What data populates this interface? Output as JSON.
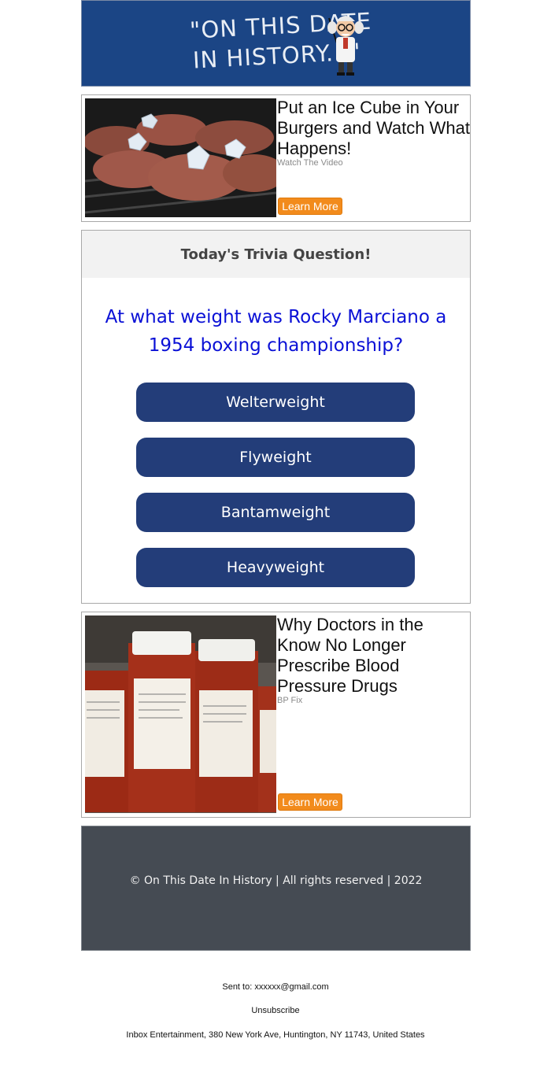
{
  "header": {
    "logo_line1": "\"ON THIS DATE",
    "logo_line2": "IN HISTORY...\""
  },
  "ads": [
    {
      "title": "Put an Ice Cube in Your Burgers and Watch What Happens!",
      "source": "Watch The Video",
      "button_label": "Learn More"
    },
    {
      "title": "Why Doctors in the Know No Longer Prescribe Blood Pressure Drugs",
      "source": "BP Fix",
      "button_label": "Learn More"
    }
  ],
  "trivia": {
    "heading": "Today's Trivia Question!",
    "question": "At what weight was Rocky Marciano a 1954 boxing championship?",
    "answers": [
      "Welterweight",
      "Flyweight",
      "Bantamweight",
      "Heavyweight"
    ]
  },
  "footer": {
    "copyright": "© On This Date In History | All rights reserved | 2022"
  },
  "meta": {
    "sent_to": "Sent to: xxxxxx@gmail.com",
    "unsubscribe": "Unsubscribe",
    "address": "Inbox Entertainment, 380 New York Ave, Huntington, NY 11743, United States"
  },
  "colors": {
    "header_bg": "#1b4585",
    "answer_bg": "#233d79",
    "question_text": "#0a10d6",
    "learn_more_bg": "#f28b1c",
    "footer_bg": "#454b53"
  }
}
